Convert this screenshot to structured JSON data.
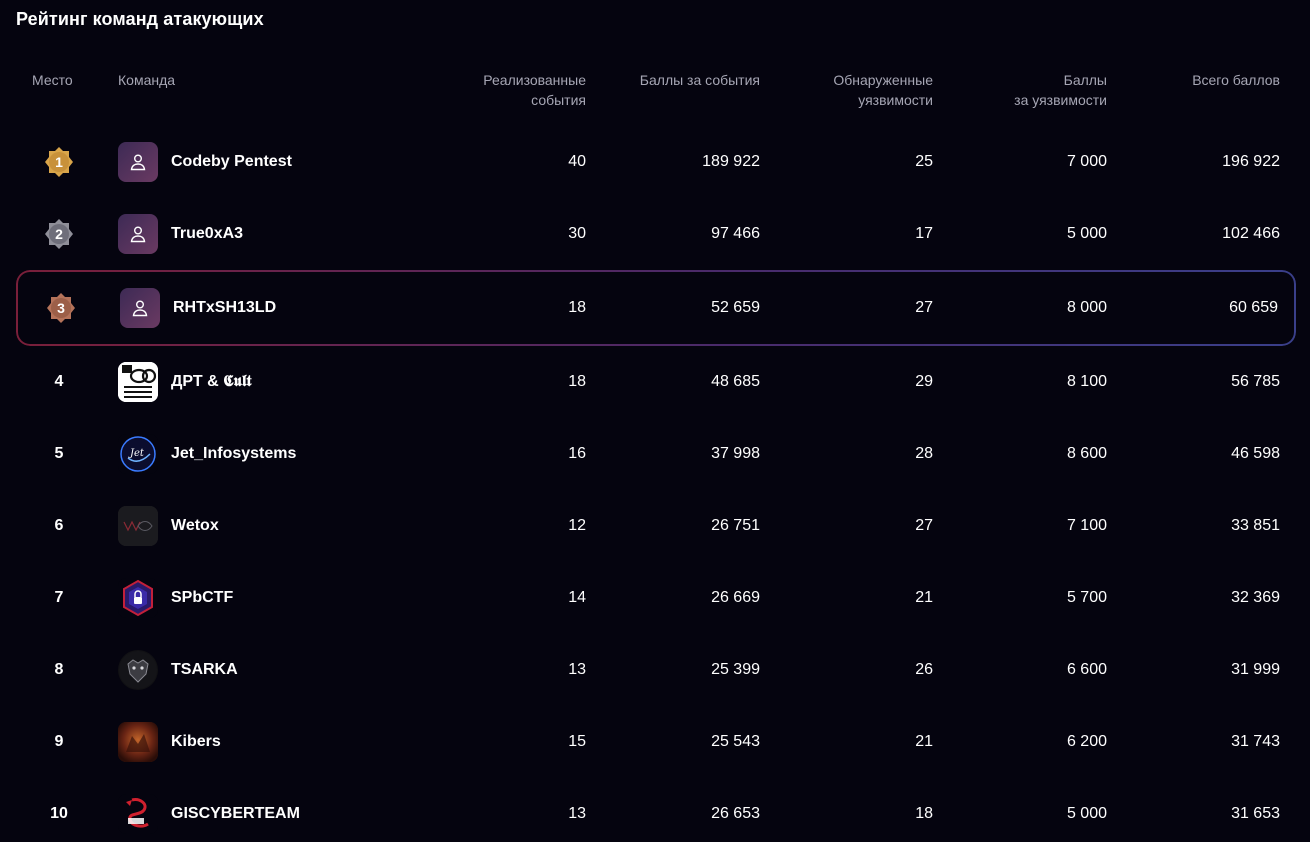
{
  "title": "Рейтинг команд атакующих",
  "columns": {
    "place": "Место",
    "team": "Команда",
    "events_line1": "Реализованные",
    "events_line2": "события",
    "event_points": "Баллы за события",
    "vulns_line1": "Обнаруженные",
    "vulns_line2": "уязвимости",
    "vuln_points_line1": "Баллы",
    "vuln_points_line2": "за уязвимости",
    "total": "Всего баллов"
  },
  "rows": [
    {
      "place": "1",
      "team": "Codeby Pentest",
      "events": "40",
      "event_points": "189 922",
      "vulns": "25",
      "vuln_points": "7 000",
      "total": "196 922",
      "medal": "gold",
      "avatar": "user-icon"
    },
    {
      "place": "2",
      "team": "True0xA3",
      "events": "30",
      "event_points": "97 466",
      "vulns": "17",
      "vuln_points": "5 000",
      "total": "102 466",
      "medal": "silver",
      "avatar": "user-icon"
    },
    {
      "place": "3",
      "team": "RHTxSH13LD",
      "events": "18",
      "event_points": "52 659",
      "vulns": "27",
      "vuln_points": "8 000",
      "total": "60 659",
      "medal": "bronze",
      "avatar": "user-icon"
    },
    {
      "place": "4",
      "team": "ДРТ & 𝕮𝖚𝖑𝖙",
      "events": "18",
      "event_points": "48 685",
      "vulns": "29",
      "vuln_points": "8 100",
      "total": "56 785",
      "avatar": "cult-logo"
    },
    {
      "place": "5",
      "team": "Jet_Infosystems",
      "events": "16",
      "event_points": "37 998",
      "vulns": "28",
      "vuln_points": "8 600",
      "total": "46 598",
      "avatar": "jet-logo"
    },
    {
      "place": "6",
      "team": "Wetox",
      "events": "12",
      "event_points": "26 751",
      "vulns": "27",
      "vuln_points": "7 100",
      "total": "33 851",
      "avatar": "wetox-logo"
    },
    {
      "place": "7",
      "team": "SPbCTF",
      "events": "14",
      "event_points": "26 669",
      "vulns": "21",
      "vuln_points": "5 700",
      "total": "32 369",
      "avatar": "spbctf-logo"
    },
    {
      "place": "8",
      "team": "TSARKA",
      "events": "13",
      "event_points": "25 399",
      "vulns": "26",
      "vuln_points": "6 600",
      "total": "31 999",
      "avatar": "tsarka-logo"
    },
    {
      "place": "9",
      "team": "Kibers",
      "events": "15",
      "event_points": "25 543",
      "vulns": "21",
      "vuln_points": "6 200",
      "total": "31 743",
      "avatar": "kibers-logo"
    },
    {
      "place": "10",
      "team": "GISCYBERTEAM",
      "events": "13",
      "event_points": "26 653",
      "vulns": "18",
      "vuln_points": "5 000",
      "total": "31 653",
      "avatar": "giscyberteam-logo"
    }
  ],
  "colors": {
    "background": "#05040f",
    "gold": "#d9a54a",
    "silver": "#8f8f99",
    "bronze": "#b5735a",
    "highlight_border_start": "#7a1f3a",
    "highlight_border_end": "#3a3f8a"
  }
}
